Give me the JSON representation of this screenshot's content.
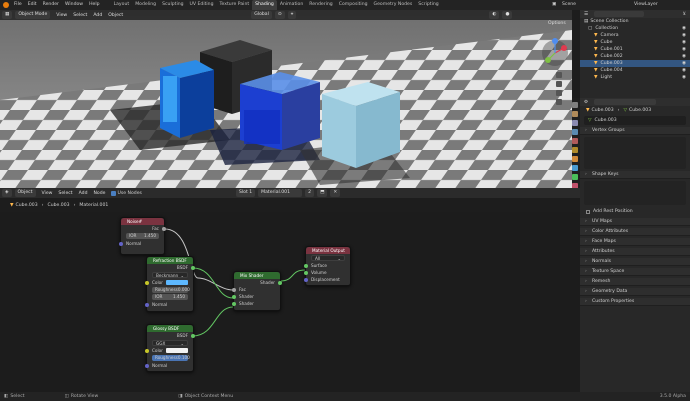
{
  "topbar": {
    "menus": [
      "File",
      "Edit",
      "Render",
      "Window",
      "Help"
    ],
    "workspaces": [
      "Layout",
      "Modeling",
      "Sculpting",
      "UV Editing",
      "Texture Paint",
      "Shading",
      "Animation",
      "Rendering",
      "Compositing",
      "Geometry Nodes",
      "Scripting"
    ],
    "active_workspace": "Shading",
    "scene": "Scene",
    "view_layer": "ViewLayer"
  },
  "viewport": {
    "mode": "Object Mode",
    "menus": [
      "View",
      "Select",
      "Add",
      "Object"
    ],
    "orientation": "Global",
    "options": "Options"
  },
  "node_editor": {
    "type": "Object",
    "menus": [
      "View",
      "Select",
      "Add",
      "Node"
    ],
    "use_nodes_label": "Use Nodes",
    "slot": "Slot 1",
    "material": "Material.001",
    "user_count": "2",
    "breadcrumb": [
      "Cube.003",
      "Cube.003",
      "Material.001"
    ],
    "nodes": {
      "noise": {
        "title": "Noise#",
        "output": "Fac",
        "ior_label": "IOR",
        "ior_value": "1.450",
        "normal": "Normal"
      },
      "refraction": {
        "title": "Refraction BSDF",
        "output": "BSDF",
        "dist": "Beckmann",
        "color": "Color",
        "rough_label": "Roughness",
        "rough_value": "0.000",
        "ior_label": "IOR",
        "ior_value": "1.450",
        "normal": "Normal"
      },
      "glossy": {
        "title": "Glossy BSDF",
        "output": "BSDF",
        "dist": "GGX",
        "color": "Color",
        "rough_label": "Roughness",
        "rough_value": "0.100",
        "normal": "Normal"
      },
      "mix": {
        "title": "Mix Shader",
        "output": "Shader",
        "fac": "Fac",
        "shader1": "Shader",
        "shader2": "Shader"
      },
      "output": {
        "title": "Material Output",
        "target": "All",
        "surface": "Surface",
        "volume": "Volume",
        "displacement": "Displacement"
      }
    }
  },
  "outliner": {
    "title": "Scene Collection",
    "items": [
      {
        "name": "Collection",
        "level": 0,
        "selected": false
      },
      {
        "name": "Camera",
        "level": 1,
        "selected": false
      },
      {
        "name": "Cube",
        "level": 1,
        "selected": false
      },
      {
        "name": "Cube.001",
        "level": 1,
        "selected": false
      },
      {
        "name": "Cube.002",
        "level": 1,
        "selected": false
      },
      {
        "name": "Cube.003",
        "level": 1,
        "selected": true
      },
      {
        "name": "Cube.004",
        "level": 1,
        "selected": false
      },
      {
        "name": "Light",
        "level": 1,
        "selected": false
      }
    ]
  },
  "properties": {
    "crumb_obj": "Cube.003",
    "crumb_mesh": "Cube.003",
    "data_name": "Cube.003",
    "sections_top": [
      "Vertex Groups",
      "Shape Keys"
    ],
    "add_rest": "Add Rest Position",
    "sections": [
      "UV Maps",
      "Color Attributes",
      "Face Maps",
      "Attributes",
      "Normals",
      "Texture Space",
      "Remesh",
      "Geometry Data",
      "Custom Properties"
    ]
  },
  "statusbar": {
    "select": "Select",
    "rotate": "Rotate View",
    "context": "Object Context Menu",
    "version": "3.5.0 Alpha"
  },
  "colors": {
    "accent": "#335681",
    "node_red": "#7a3340",
    "node_green": "#2f6b2f"
  }
}
